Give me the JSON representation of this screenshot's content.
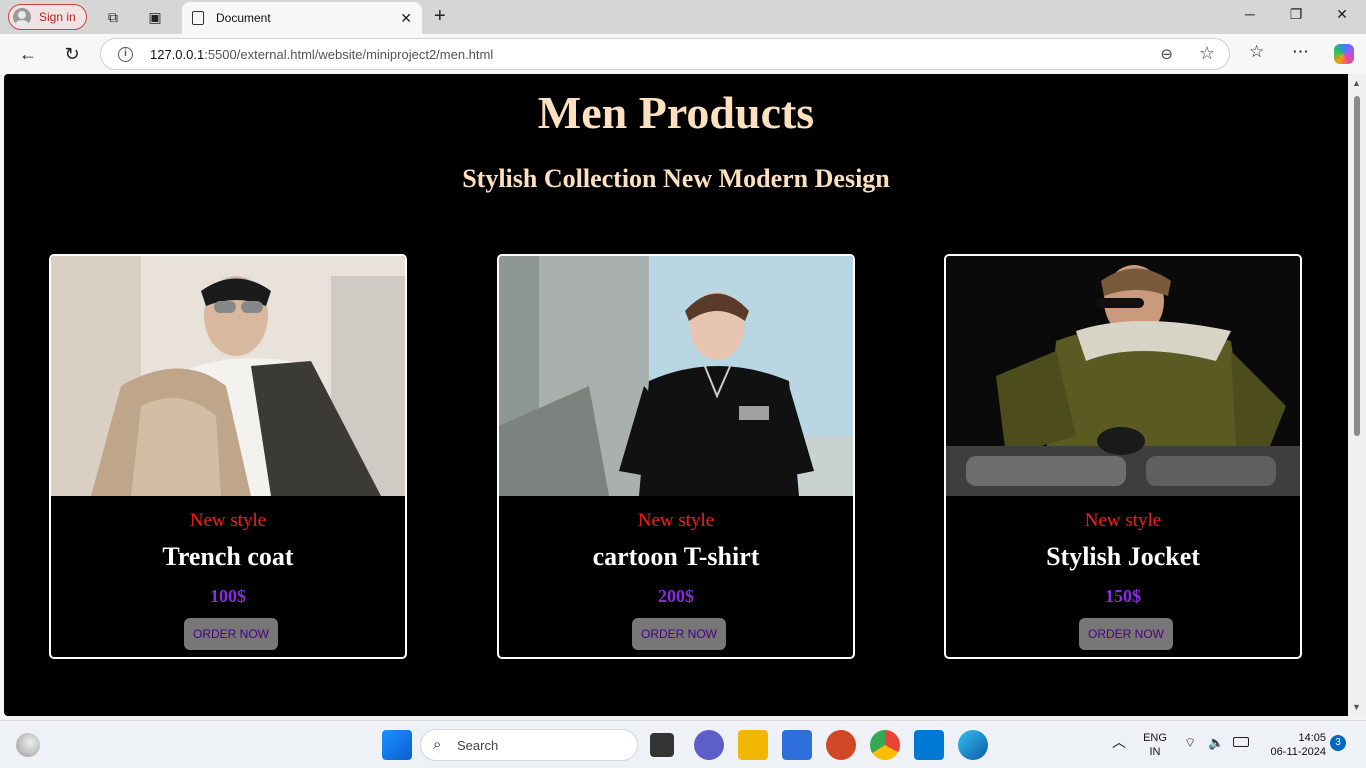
{
  "browser": {
    "signin_label": "Sign in",
    "tab_title": "Document",
    "url_host": "127.0.0.1",
    "url_rest": ":5500/external.html/website/miniproject2/men.html"
  },
  "page": {
    "title": "Men Products",
    "subtitle": "Stylish Collection New Modern Design",
    "products": [
      {
        "tag": "New style",
        "name": "Trench coat",
        "price": "100$",
        "button": "ORDER NOW"
      },
      {
        "tag": "New style",
        "name": "cartoon T-shirt",
        "price": "200$",
        "button": "ORDER NOW"
      },
      {
        "tag": "New style",
        "name": "Stylish Jocket",
        "price": "150$",
        "button": "ORDER NOW"
      }
    ]
  },
  "taskbar": {
    "search_placeholder": "Search",
    "lang_top": "ENG",
    "lang_bottom": "IN",
    "time": "14:05",
    "date": "06-11-2024",
    "notification_count": "3"
  },
  "colors": {
    "title": "#fde0bf",
    "tag": "#ff1a1a",
    "price": "#8a2be2",
    "button_bg": "#777777",
    "button_text": "#4b0082"
  }
}
